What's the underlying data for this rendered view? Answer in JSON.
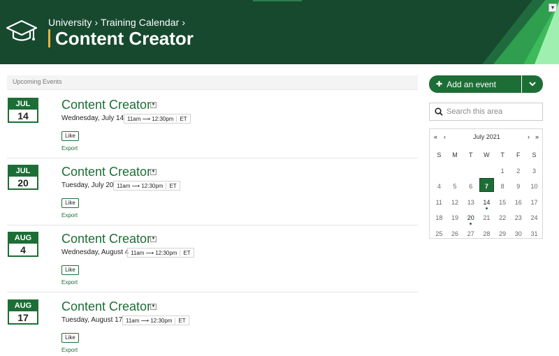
{
  "header": {
    "breadcrumb": "University › Training Calendar ›",
    "title": "Content Creator",
    "colors": {
      "background": "#17492f",
      "accent_bar": "#e8b33a"
    }
  },
  "upcoming_label": "Upcoming Events",
  "events": [
    {
      "month": "JUL",
      "day": "14",
      "title": "Content Creator",
      "date": "Wednesday, July 14",
      "time": "11am ⟶ 12:30pm",
      "tz": "ET",
      "like": "Like",
      "export": "Export"
    },
    {
      "month": "JUL",
      "day": "20",
      "title": "Content Creator",
      "date": "Tuesday, July 20",
      "time": "11am ⟶ 12:30pm",
      "tz": "ET",
      "like": "Like",
      "export": "Export"
    },
    {
      "month": "AUG",
      "day": "4",
      "title": "Content Creator",
      "date": "Wednesday, August 4",
      "time": "11am ⟶ 12:30pm",
      "tz": "ET",
      "like": "Like",
      "export": "Export"
    },
    {
      "month": "AUG",
      "day": "17",
      "title": "Content Creator",
      "date": "Tuesday, August 17",
      "time": "11am ⟶ 12:30pm",
      "tz": "ET",
      "like": "Like",
      "export": "Export"
    }
  ],
  "sidebar": {
    "add_event": {
      "icon": "plus-icon",
      "label": "Add an event"
    },
    "search": {
      "placeholder": "Search this area",
      "icon": "search-icon"
    },
    "calendar": {
      "month_label": "July 2021",
      "nav": {
        "prev_year": "«",
        "prev_month": "‹",
        "next_month": "›",
        "next_year": "»"
      },
      "weekdays": [
        "S",
        "M",
        "T",
        "W",
        "T",
        "F",
        "S"
      ],
      "weeks": [
        [
          "",
          "",
          "",
          "",
          "1",
          "2",
          "3"
        ],
        [
          "4",
          "5",
          "6",
          "7",
          "8",
          "9",
          "10"
        ],
        [
          "11",
          "12",
          "13",
          "14",
          "15",
          "16",
          "17"
        ],
        [
          "18",
          "19",
          "20",
          "21",
          "22",
          "23",
          "24"
        ],
        [
          "25",
          "26",
          "27",
          "28",
          "29",
          "30",
          "31"
        ]
      ],
      "today": "7",
      "event_days": [
        "14",
        "20"
      ],
      "accent": "#1d6e36"
    }
  }
}
